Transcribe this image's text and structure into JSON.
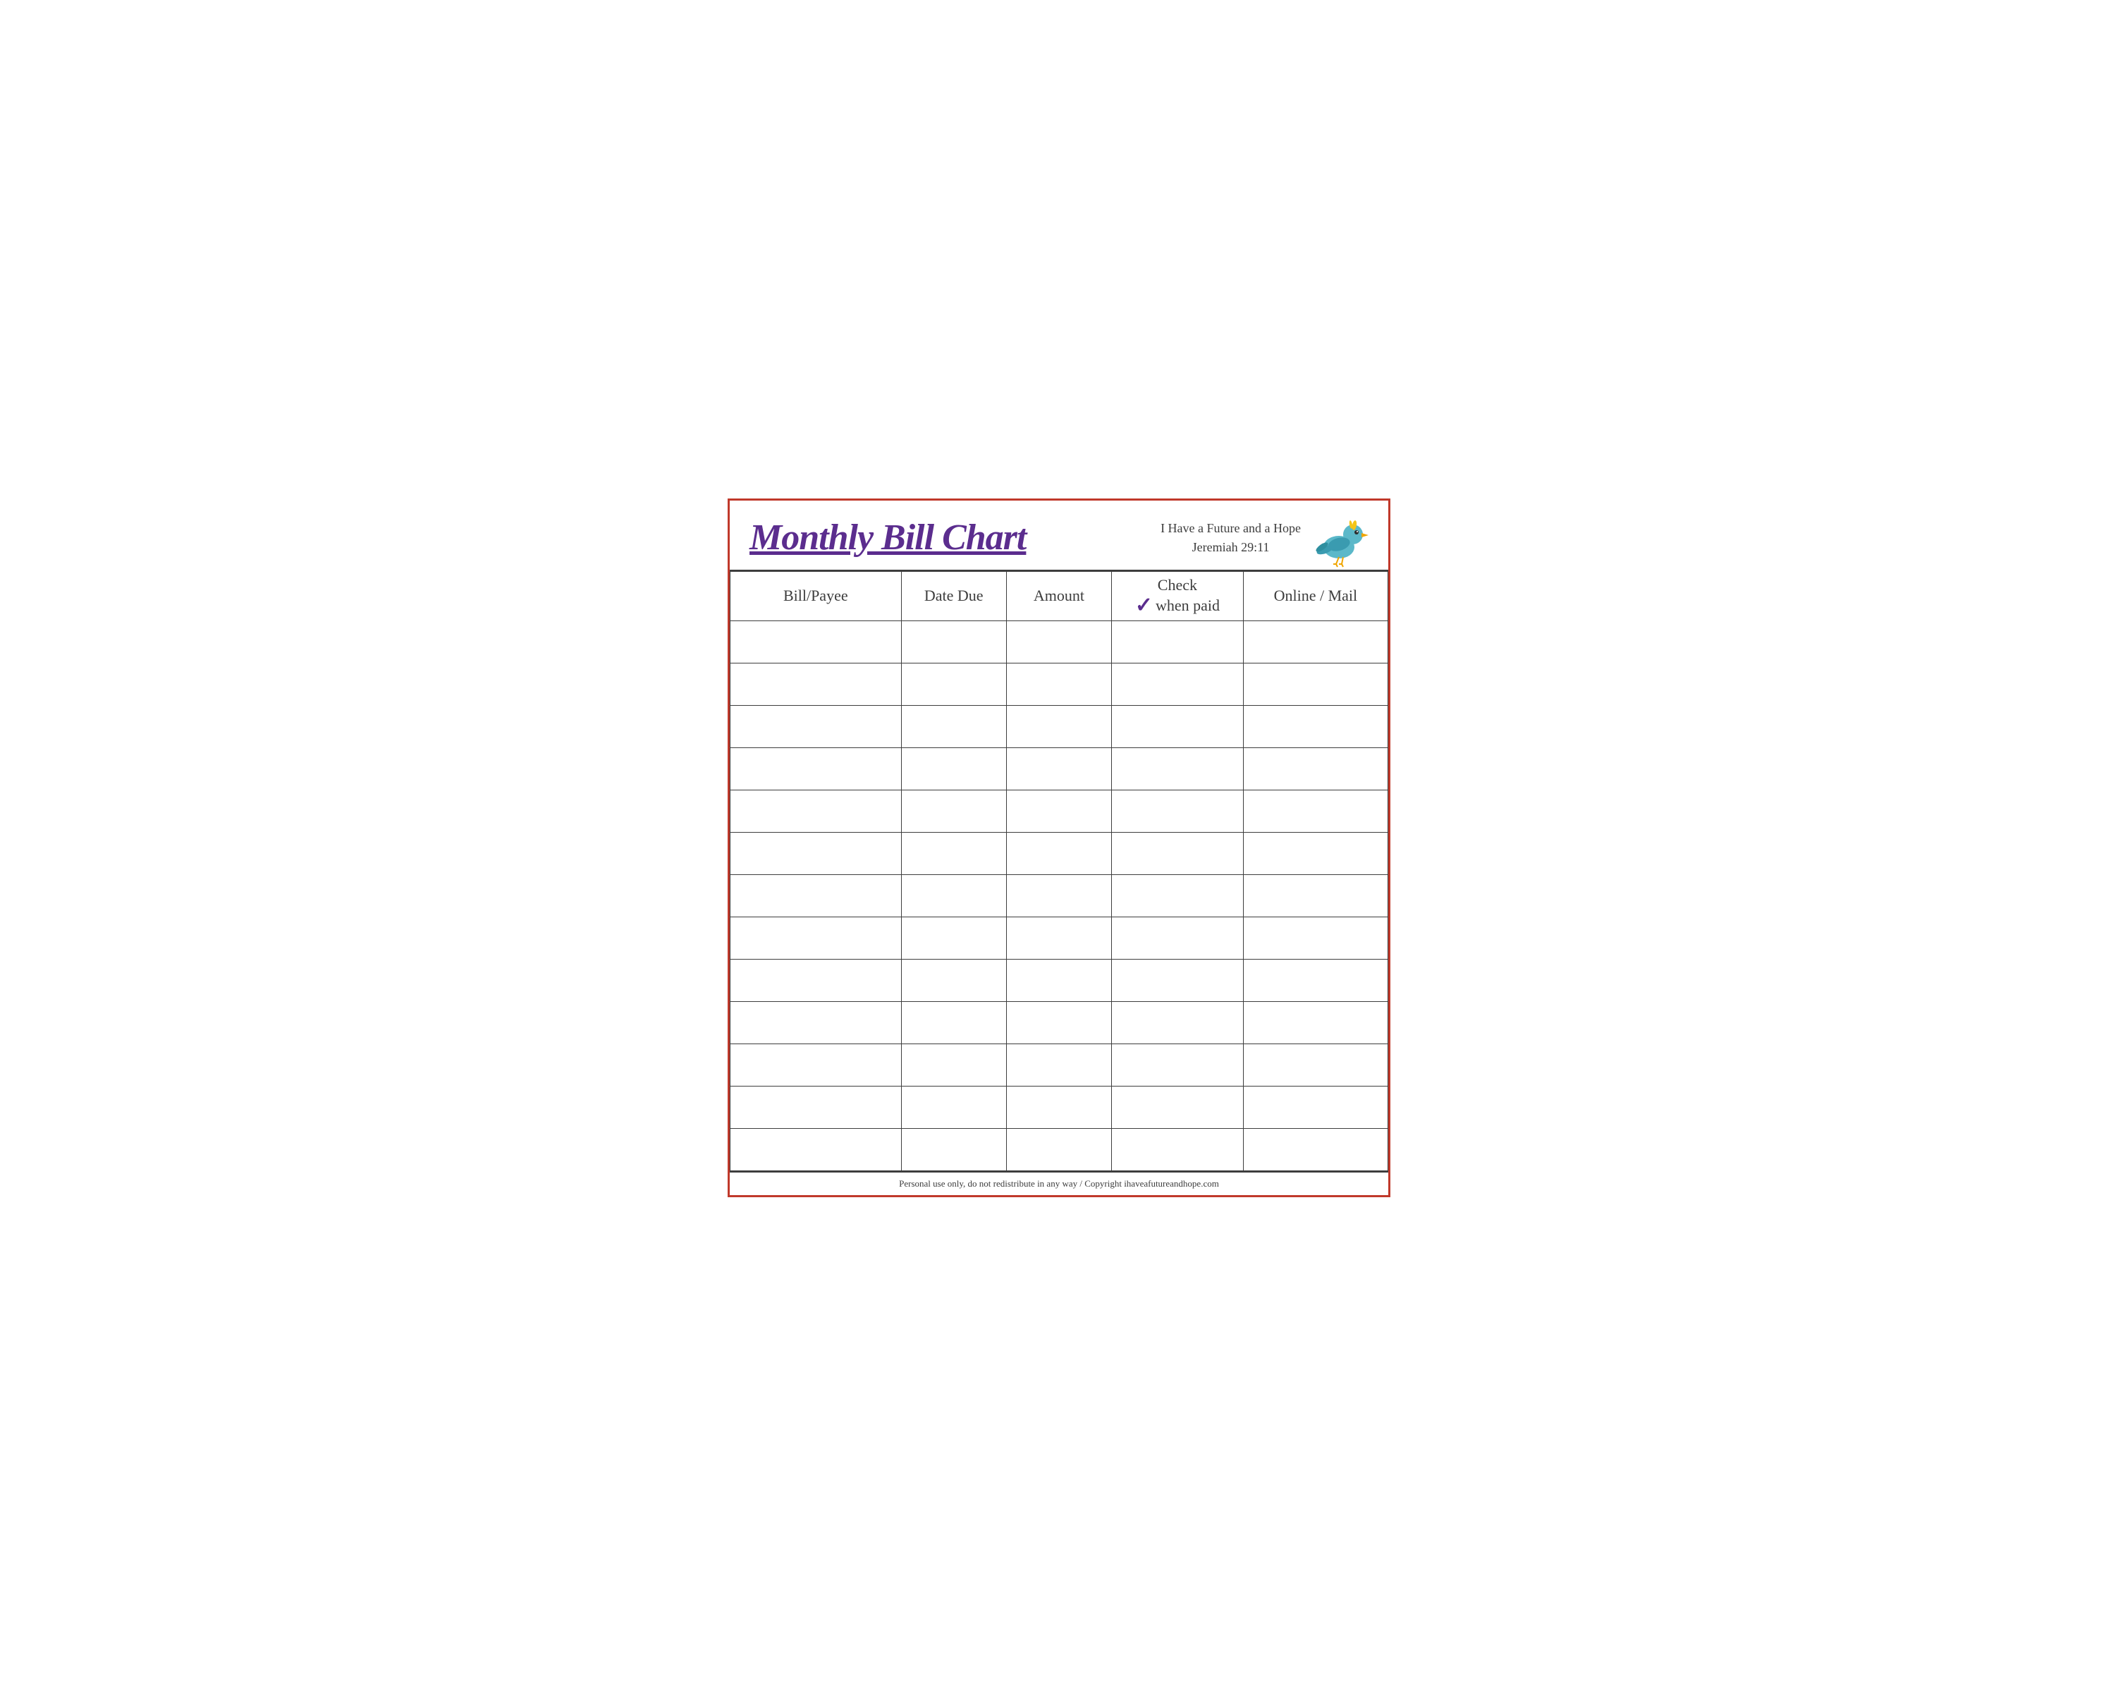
{
  "header": {
    "title": "Monthly Bill Chart",
    "subtitle_line1": "I Have a Future and a Hope",
    "subtitle_line2": "Jeremiah 29:11"
  },
  "table": {
    "columns": [
      {
        "key": "bill",
        "label": "Bill/Payee"
      },
      {
        "key": "date",
        "label": "Date Due"
      },
      {
        "key": "amount",
        "label": "Amount"
      },
      {
        "key": "check",
        "label_top": "Check",
        "label_bottom": "when paid",
        "has_checkmark": true
      },
      {
        "key": "online",
        "label": "Online / Mail"
      }
    ],
    "row_count": 13
  },
  "footer": {
    "text": "Personal use only, do not redistribute in any way / Copyright ihaveafutureandhope.com"
  }
}
